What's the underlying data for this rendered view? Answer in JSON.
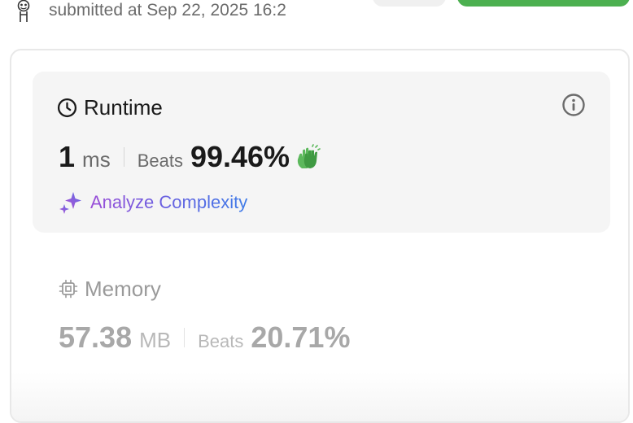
{
  "header": {
    "submitted_text": "submitted at Sep 22, 2025 16:2"
  },
  "runtime": {
    "title": "Runtime",
    "value": "1",
    "unit": "ms",
    "beats_label": "Beats",
    "beats_value": "99.46%",
    "analyze_label": "Analyze Complexity"
  },
  "memory": {
    "title": "Memory",
    "value": "57.38",
    "unit": "MB",
    "beats_label": "Beats",
    "beats_value": "20.71%"
  },
  "icons": {
    "avatar": "avatar-icon",
    "runtime": "clock-icon",
    "info": "info-icon",
    "celebrate": "clapping-hands-icon",
    "analyze": "sparkle-icon",
    "memory": "chip-icon"
  },
  "colors": {
    "accent_green": "#4cb050",
    "clap_green": "#5cb85c",
    "analyze_gradient_start": "#9b4fd8",
    "analyze_gradient_end": "#3f7ce8",
    "panel_bg": "#f5f5f5"
  }
}
